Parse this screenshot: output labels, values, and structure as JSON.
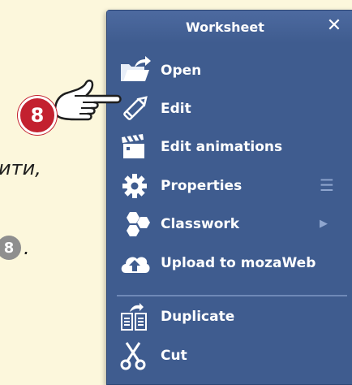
{
  "background": {
    "line1": "ити,",
    "line2": ".",
    "circle_number": "8"
  },
  "menu": {
    "title": "Worksheet",
    "close_label": "✕",
    "items": [
      {
        "label": "Open",
        "icon": "folder-open-icon"
      },
      {
        "label": "Edit",
        "icon": "pencil-icon"
      },
      {
        "label": "Edit animations",
        "icon": "clapperboard-icon"
      },
      {
        "label": "Properties",
        "icon": "gear-icon",
        "extra": "☰"
      },
      {
        "label": "Classwork",
        "icon": "hexagons-icon",
        "extra": "▶"
      },
      {
        "label": "Upload to mozaWeb",
        "icon": "cloud-upload-icon"
      },
      {
        "label": "Duplicate",
        "icon": "duplicate-icon"
      },
      {
        "label": "Cut",
        "icon": "scissors-icon"
      }
    ]
  },
  "callout": {
    "number": "8"
  },
  "colors": {
    "menu_bg": "#3f5c8f",
    "badge": "#c3212f",
    "page_bg": "#fcf7dc"
  }
}
